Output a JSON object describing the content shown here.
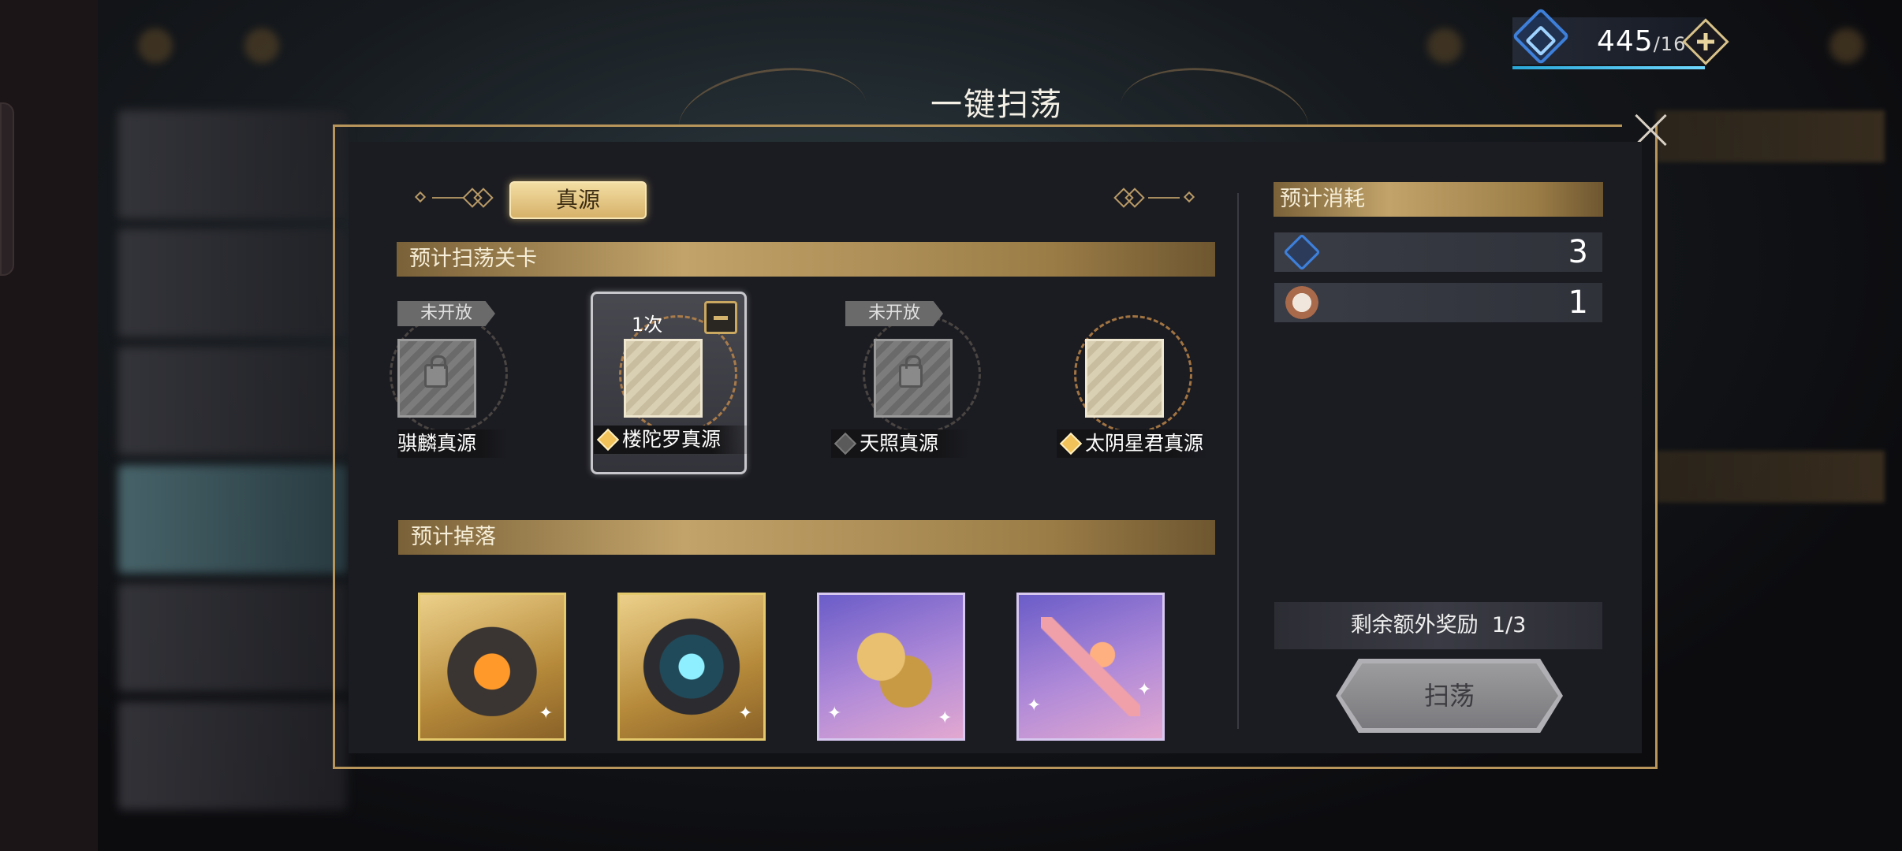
{
  "resource": {
    "value": "445",
    "max": "/16",
    "icon": "energy-icon"
  },
  "modal": {
    "title": "一键扫荡"
  },
  "tabs": [
    {
      "label": "真源",
      "active": true
    }
  ],
  "sections": {
    "stages_header": "预计扫荡关卡",
    "drops_header": "预计掉落",
    "cost_header": "预计消耗"
  },
  "stages": [
    {
      "name": "骐麟真源",
      "tag": "未开放",
      "locked": true,
      "selected": false
    },
    {
      "name": "楼陀罗真源",
      "count": "1次",
      "locked": false,
      "selected": true
    },
    {
      "name": "天照真源",
      "tag": "未开放",
      "locked": true,
      "selected": false
    },
    {
      "name": "太阴星君真源",
      "locked": false,
      "selected": false
    }
  ],
  "drops": [
    {
      "icon": "ember-cube-icon",
      "frame": "gold"
    },
    {
      "icon": "crest-disc-icon",
      "frame": "gold"
    },
    {
      "icon": "gold-coins-icon",
      "frame": "violet"
    },
    {
      "icon": "star-wand-icon",
      "frame": "violet"
    }
  ],
  "costs": [
    {
      "icon": "energy-icon",
      "value": "3"
    },
    {
      "icon": "pocket-watch-icon",
      "value": "1"
    }
  ],
  "bonus": {
    "label": "剩余额外奖励",
    "value": "1/3"
  },
  "sweep_button": {
    "label": "扫荡"
  },
  "colors": {
    "accent_gold": "#c2a46a",
    "frame_gold": "#b8955a",
    "energy_blue": "#3d7fd9",
    "panel": "#1b1c22"
  }
}
